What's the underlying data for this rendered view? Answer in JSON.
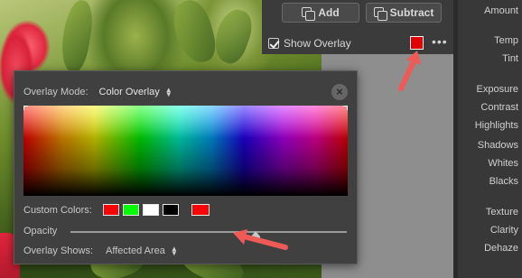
{
  "mask_panel": {
    "add_label": "Add",
    "subtract_label": "Subtract",
    "show_overlay_label": "Show Overlay",
    "show_overlay_checked": true,
    "overlay_color": "#e00000",
    "more_label": "•••"
  },
  "right_panel": {
    "labels": [
      "Amount",
      "Temp",
      "Tint",
      "Exposure",
      "Contrast",
      "Highlights",
      "Shadows",
      "Whites",
      "Blacks",
      "Texture",
      "Clarity",
      "Dehaze"
    ]
  },
  "popover": {
    "mode_label": "Overlay Mode:",
    "mode_value": "Color Overlay",
    "close_label": "×",
    "custom_colors_label": "Custom Colors:",
    "custom_colors": [
      "#ff0000",
      "#00ff00",
      "#ffffff",
      "#000000"
    ],
    "selected_color": "#ff0000",
    "opacity_label": "Opacity",
    "opacity_value": 0.67,
    "shows_label": "Overlay Shows:",
    "shows_value": "Affected Area"
  },
  "annotation_color": "#ef5a57"
}
